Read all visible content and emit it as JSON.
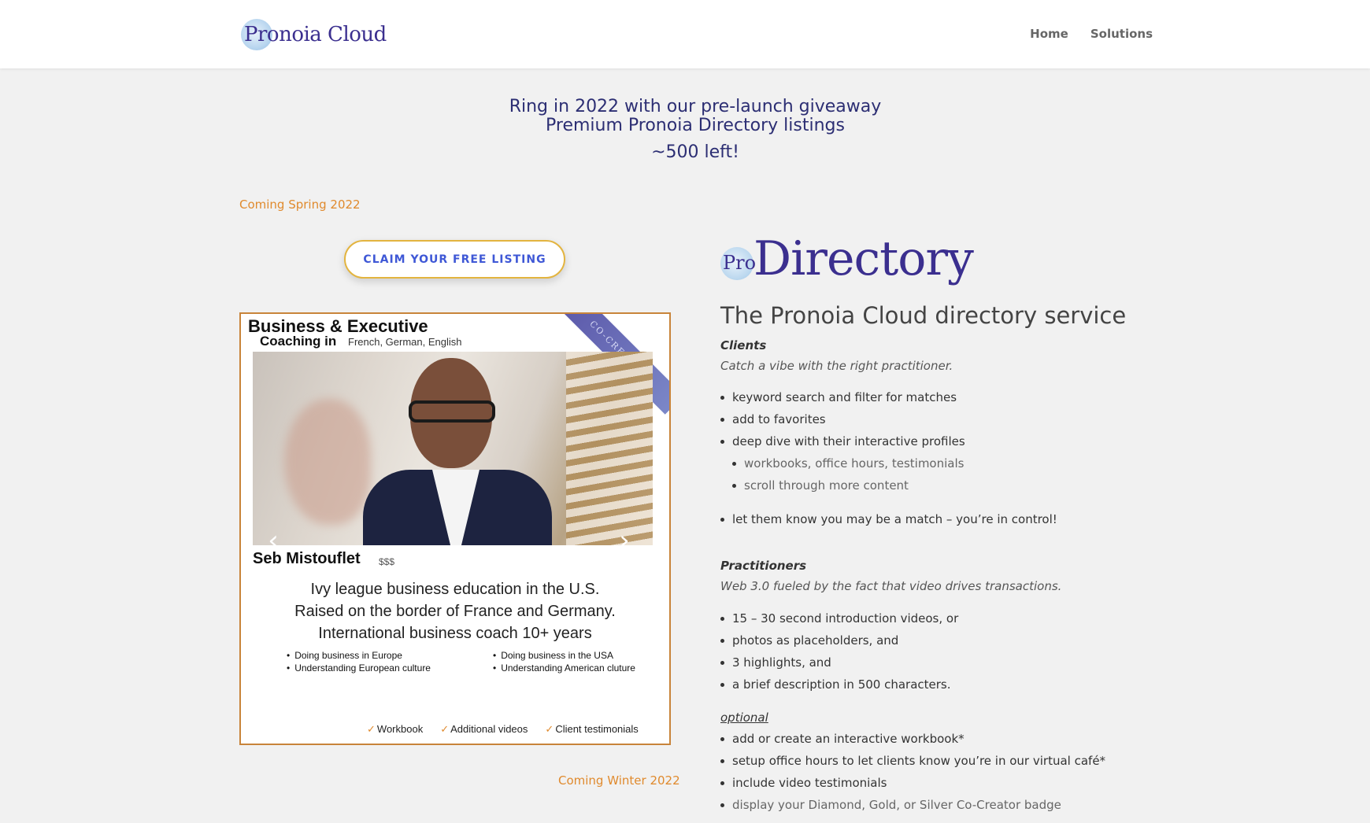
{
  "header": {
    "logo_text": "Pronoia Cloud",
    "nav": [
      {
        "label": "Home"
      },
      {
        "label": "Solutions"
      }
    ]
  },
  "hero": {
    "line1": "Ring in 2022 with our pre-launch giveaway",
    "line2": "Premium Pronoia Directory listings",
    "line3": "~500 left!"
  },
  "coming_spring": "Coming Spring 2022",
  "coming_winter": "Coming Winter 2022",
  "claim_button": "CLAIM YOUR FREE LISTING",
  "card": {
    "title_line1": "Business & Executive",
    "title_line2": "Coaching in",
    "languages": "French, German, English",
    "ribbon": "CO-CREATOR",
    "name": "Seb Mistouflet",
    "price": "$$$",
    "bio": [
      "Ivy league business education in the U.S.",
      "Raised on the border of France and Germany.",
      "International business coach 10+ years"
    ],
    "bullets_left": [
      "Doing business in Europe",
      "Understanding European culture"
    ],
    "bullets_right": [
      "Doing business in the USA",
      "Understanding American cluture"
    ],
    "features": [
      "Workbook",
      "Additional videos",
      "Client testimonials"
    ],
    "prev_icon": "chevron-left-icon",
    "next_icon": "chevron-right-icon"
  },
  "directory": {
    "logo_pro": "Pro",
    "logo_directory": "Directory",
    "heading": "The Pronoia Cloud directory service",
    "clients_label": "Clients",
    "clients_sub": "Catch a vibe with the right practitioner.",
    "clients_items": [
      "keyword search and filter for matches",
      "add to favorites",
      "deep dive with their interactive profiles"
    ],
    "clients_subitems": [
      "workbooks, office hours, testimonials",
      "scroll through more content"
    ],
    "clients_last": "let them know you may be a match – you’re in control!",
    "practitioners_label": "Practitioners",
    "practitioners_sub": "Web 3.0 fueled by the fact that video drives transactions.",
    "practitioners_items": [
      "15 – 30 second introduction videos, or",
      "photos as placeholders, and",
      "3 highlights, and",
      "a brief description in 500 characters."
    ],
    "optional_label": "optional",
    "optional_items": [
      "add or create an interactive workbook*",
      "setup office hours to let clients know you’re in our virtual café*",
      "include video testimonials",
      "display your Diamond, Gold, or Silver Co-Creator badge"
    ]
  },
  "colors": {
    "brand_navy": "#2c2e73",
    "brand_purple": "#3b2f8f",
    "accent_orange": "#e08a2d",
    "button_text": "#3f58d6",
    "button_border": "#e3b43f"
  }
}
